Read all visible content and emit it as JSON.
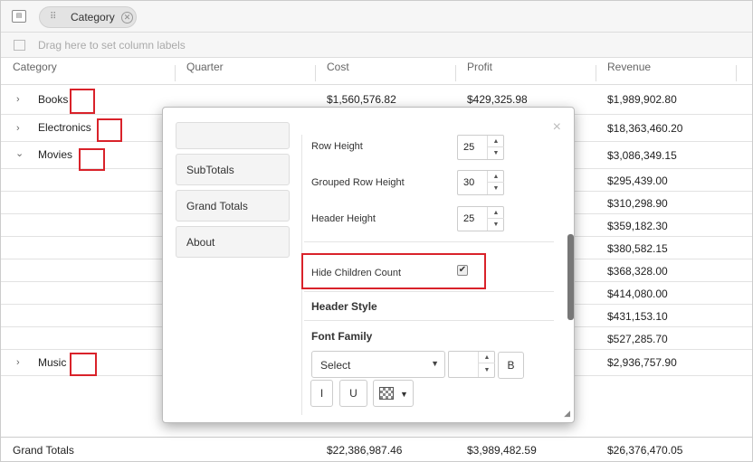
{
  "group_bar": {
    "panel_icon": "pivot-panel-icon",
    "chip_label": "Category",
    "chip_close_icon": "remove-circle-icon",
    "chip_grip_icon": "drag-grip-icon"
  },
  "column_bar": {
    "hint": "Drag here to set column labels",
    "icon": "column-labels-icon"
  },
  "columns": [
    "Category",
    "Quarter",
    "Cost",
    "Profit",
    "Revenue"
  ],
  "rows": [
    {
      "category": "Books",
      "cost": "$1,560,576.82",
      "profit": "$429,325.98",
      "revenue": "$1,989,902.80",
      "expander": "›"
    },
    {
      "category": "Electronics",
      "cost": "",
      "profit": "",
      "revenue": "$18,363,460.20",
      "expander": "›"
    },
    {
      "category": "Movies",
      "cost": "",
      "profit": "",
      "revenue": "$3,086,349.15",
      "expander": "⌄"
    },
    {
      "category": "",
      "revenue": "$295,439.00"
    },
    {
      "category": "",
      "revenue": "$310,298.90"
    },
    {
      "category": "",
      "revenue": "$359,182.30"
    },
    {
      "category": "",
      "revenue": "$380,582.15"
    },
    {
      "category": "",
      "revenue": "$368,328.00"
    },
    {
      "category": "",
      "revenue": "$414,080.00"
    },
    {
      "category": "",
      "revenue": "$431,153.10"
    },
    {
      "category": "",
      "revenue": "$527,285.70"
    },
    {
      "category": "Music",
      "cost": "",
      "profit": "",
      "revenue": "$2,936,757.90",
      "expander": "›"
    }
  ],
  "grand_totals": {
    "label": "Grand Totals",
    "cost": "$22,386,987.46",
    "profit": "$3,989,482.59",
    "revenue": "$26,376,470.05"
  },
  "highlight_color": "#d9222a",
  "dialog": {
    "close": "×",
    "nav": [
      "SubTotals",
      "Grand Totals",
      "About"
    ],
    "settings": {
      "row_height_label": "Row Height",
      "row_height_value": "25",
      "grouped_row_height_label": "Grouped Row Height",
      "grouped_row_height_value": "30",
      "header_height_label": "Header Height",
      "header_height_value": "25",
      "hide_children_label": "Hide Children Count",
      "hide_children_checked": "✔"
    },
    "header_style_title": "Header Style",
    "font_family_title": "Font Family",
    "font_select_value": "Select",
    "bold_label": "B",
    "italic_label": "I",
    "underline_label": "U",
    "spinner_up": "▲",
    "spinner_down": "▼",
    "dropdown_arrow": "▼"
  }
}
